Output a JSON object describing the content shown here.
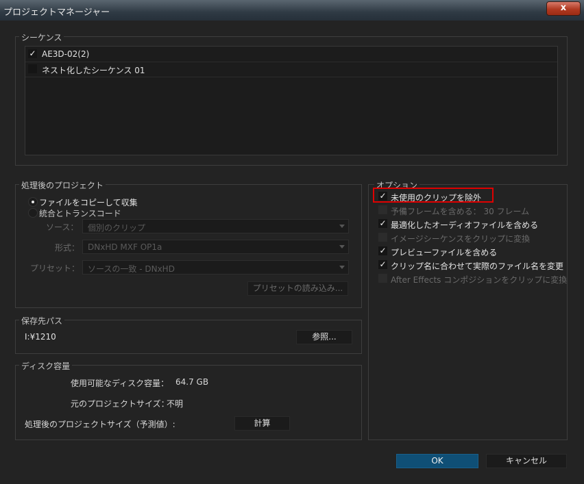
{
  "window": {
    "title": "プロジェクトマネージャー",
    "close_glyph": "x"
  },
  "sequences": {
    "legend": "シーケンス",
    "items": [
      {
        "label": "AE3D-02(2)",
        "checked": true,
        "mark": "✓"
      },
      {
        "label": "ネスト化したシーケンス 01",
        "checked": false,
        "mark": ""
      }
    ]
  },
  "resulting_project": {
    "legend": "処理後のプロジェクト",
    "radios": [
      {
        "label": "ファイルをコピーして収集",
        "selected": true
      },
      {
        "label": "統合とトランスコード",
        "selected": false
      }
    ],
    "source_label": "ソース：",
    "source_value": "個別のクリップ",
    "format_label": "形式：",
    "format_value": "DNxHD MXF OP1a",
    "preset_label": "プリセット：",
    "preset_value": "ソースの一致 - DNxHD",
    "import_preset_button": "プリセットの読み込み..."
  },
  "destination": {
    "legend": "保存先パス",
    "path": "I:¥1210",
    "browse_button": "参照..."
  },
  "disk_space": {
    "legend": "ディスク容量",
    "available_label": "使用可能なディスク容量：",
    "available_value": "64.7 GB",
    "original_label": "元のプロジェクトサイズ：",
    "original_value": "不明",
    "resulting_label": "処理後のプロジェクトサイズ（予測値）:",
    "calculate_button": "計算"
  },
  "options": {
    "legend": "オプション",
    "items": [
      {
        "label": "未使用のクリップを除外",
        "checked": true,
        "enabled": true,
        "mark": "✓"
      },
      {
        "label": "予備フレームを含める： 30 フレーム",
        "checked": false,
        "enabled": false,
        "mark": ""
      },
      {
        "label": "最適化したオーディオファイルを含める",
        "checked": true,
        "enabled": true,
        "mark": "✓"
      },
      {
        "label": "イメージシーケンスをクリップに変換",
        "checked": false,
        "enabled": false,
        "mark": ""
      },
      {
        "label": "プレビューファイルを含める",
        "checked": true,
        "enabled": true,
        "mark": "✓"
      },
      {
        "label": "クリップ名に合わせて実際のファイル名を変更",
        "checked": true,
        "enabled": true,
        "mark": "✓"
      },
      {
        "label": "After Effects コンポジションをクリップに変換",
        "checked": false,
        "enabled": false,
        "mark": ""
      }
    ]
  },
  "footer": {
    "ok": "OK",
    "cancel": "キャンセル"
  },
  "colors": {
    "accent": "#0f4f76",
    "highlight": "#e00000"
  }
}
